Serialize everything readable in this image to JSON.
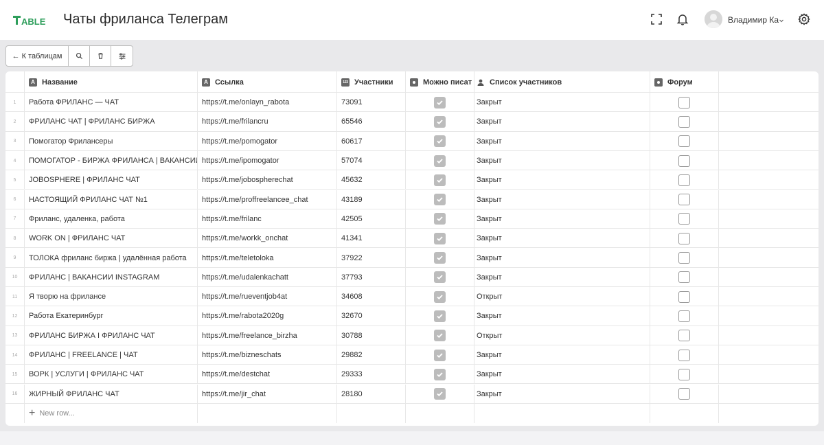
{
  "app": {
    "logo_text": "TABLE",
    "title": "Чаты фриланса Телеграм"
  },
  "header": {
    "user_name": "Владимир Ка"
  },
  "toolbar": {
    "back_label": "← К таблицам"
  },
  "columns": [
    {
      "label": "Название",
      "icon": "text-type-icon"
    },
    {
      "label": "Ссылка",
      "icon": "text-type-icon"
    },
    {
      "label": "Участники",
      "icon": "number-type-icon"
    },
    {
      "label": "Можно писат",
      "icon": "checkbox-type-icon"
    },
    {
      "label": "Список участников",
      "icon": "user-type-icon"
    },
    {
      "label": "Форум",
      "icon": "checkbox-type-icon"
    }
  ],
  "rows": [
    {
      "n": "1",
      "name": "Работа ФРИЛАНС — ЧАТ",
      "link": "https://t.me/onlayn_rabota",
      "members": "73091",
      "can_write": true,
      "list": "Закрыт",
      "forum": false
    },
    {
      "n": "2",
      "name": "ФРИЛАНС ЧАТ | ФРИЛАНС БИРЖА",
      "link": "https://t.me/frilancru",
      "members": "65546",
      "can_write": true,
      "list": "Закрыт",
      "forum": false
    },
    {
      "n": "3",
      "name": "Помогатор Фрилансеры",
      "link": "https://t.me/pomogator",
      "members": "60617",
      "can_write": true,
      "list": "Закрыт",
      "forum": false
    },
    {
      "n": "4",
      "name": "ПОМОГАТОР - БИРЖА ФРИЛАНСА | ВАКАНСИИ",
      "link": "https://t.me/ipomogator",
      "members": "57074",
      "can_write": true,
      "list": "Закрыт",
      "forum": false
    },
    {
      "n": "5",
      "name": "JOBOSPHERE | ФРИЛАНС ЧАТ",
      "link": "https://t.me/jobospherechat",
      "members": "45632",
      "can_write": true,
      "list": "Закрыт",
      "forum": false
    },
    {
      "n": "6",
      "name": "НАСТОЯЩИЙ ФРИЛАНС ЧАТ №1",
      "link": "https://t.me/proffreelancee_chat",
      "members": "43189",
      "can_write": true,
      "list": "Закрыт",
      "forum": false
    },
    {
      "n": "7",
      "name": "Фриланс, удаленка, работа",
      "link": "https://t.me/frilanc",
      "members": "42505",
      "can_write": true,
      "list": "Закрыт",
      "forum": false
    },
    {
      "n": "8",
      "name": "WORK ON | ФРИЛАНС ЧАТ",
      "link": "https://t.me/workk_onchat",
      "members": "41341",
      "can_write": true,
      "list": "Закрыт",
      "forum": false
    },
    {
      "n": "9",
      "name": "ТОЛОКА фриланс биржа | удалённая работа",
      "link": "https://t.me/teletoloka",
      "members": "37922",
      "can_write": true,
      "list": "Закрыт",
      "forum": false
    },
    {
      "n": "10",
      "name": "ФРИЛАНС | ВАКАНСИИ INSTAGRAM",
      "link": "https://t.me/udalenkachatt",
      "members": "37793",
      "can_write": true,
      "list": "Закрыт",
      "forum": false
    },
    {
      "n": "11",
      "name": "Я творю на фрилансе",
      "link": "https://t.me/rueventjob4at",
      "members": "34608",
      "can_write": true,
      "list": "Открыт",
      "forum": false
    },
    {
      "n": "12",
      "name": "Работа Екатеринбург",
      "link": "https://t.me/rabota2020g",
      "members": "32670",
      "can_write": true,
      "list": "Закрыт",
      "forum": false
    },
    {
      "n": "13",
      "name": "ФРИЛАНС БИРЖА I ФРИЛАНС ЧАТ",
      "link": "https://t.me/freelance_birzha",
      "members": "30788",
      "can_write": true,
      "list": "Открыт",
      "forum": false
    },
    {
      "n": "14",
      "name": "ФРИЛАНС | FREELANCE | ЧАТ",
      "link": "https://t.me/bizneschats",
      "members": "29882",
      "can_write": true,
      "list": "Закрыт",
      "forum": false
    },
    {
      "n": "15",
      "name": "ВОРК | УСЛУГИ | ФРИЛАНС ЧАТ",
      "link": "https://t.me/destchat",
      "members": "29333",
      "can_write": true,
      "list": "Закрыт",
      "forum": false
    },
    {
      "n": "16",
      "name": "ЖИРНЫЙ ФРИЛАНС ЧАТ",
      "link": "https://t.me/jir_chat",
      "members": "28180",
      "can_write": true,
      "list": "Закрыт",
      "forum": false
    }
  ],
  "new_row_label": "New row...",
  "colors": {
    "brand": "#2e9e5b",
    "checked": "#bcbcbc"
  }
}
